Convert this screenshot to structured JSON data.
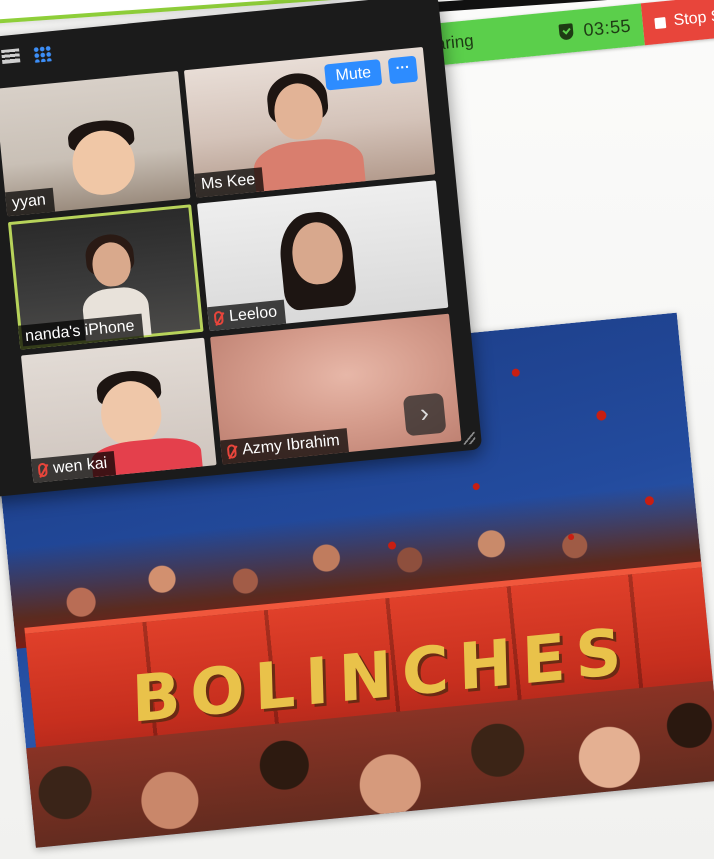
{
  "share_bar": {
    "label": "n sharing",
    "timer": "03:55",
    "stop_label": "Stop S"
  },
  "zoom": {
    "mute_label": "Mute",
    "more_label": "···",
    "next_glyph": "›",
    "participants": [
      {
        "name": "yyan",
        "muted": false
      },
      {
        "name": "Ms Kee",
        "muted": false
      },
      {
        "name": "nanda's iPhone",
        "muted": false,
        "active_speaker": true
      },
      {
        "name": "Leeloo",
        "muted": true
      },
      {
        "name": "wen kai",
        "muted": true
      },
      {
        "name": "Azmy Ibrahim",
        "muted": true
      }
    ]
  },
  "slide": {
    "truck_text": "BOLINCHES"
  },
  "colors": {
    "share_green": "#5bcf4b",
    "stop_red": "#e8453b",
    "zoom_blue": "#2d8cff",
    "active_outline": "#b7d35a"
  }
}
